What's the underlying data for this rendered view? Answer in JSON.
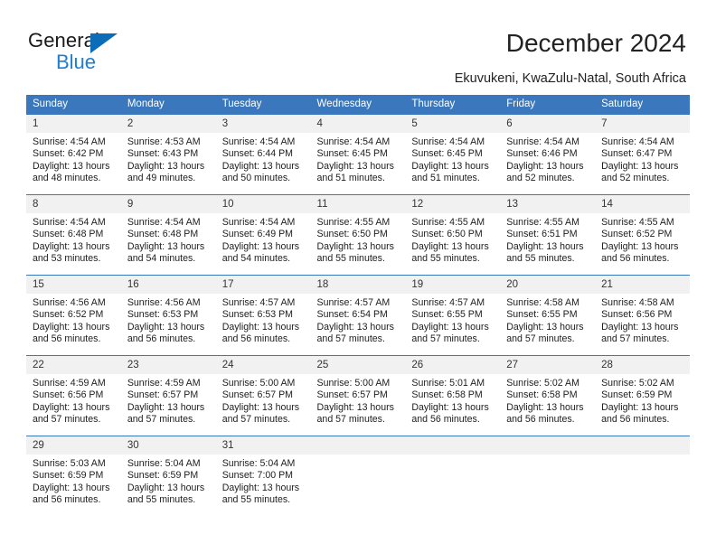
{
  "brand": {
    "name_top": "General",
    "name_bottom": "Blue",
    "triangle_color": "#0b6cb7",
    "blue_text_color": "#1b7fd4"
  },
  "header": {
    "title": "December 2024",
    "location": "Ekuvukeni, KwaZulu-Natal, South Africa"
  },
  "theme": {
    "header_bg": "#3b77bc",
    "daynum_bg": "#f1f1f1",
    "grid_line": "#3b77bc",
    "text": "#1d1d1d"
  },
  "weekdays": [
    "Sunday",
    "Monday",
    "Tuesday",
    "Wednesday",
    "Thursday",
    "Friday",
    "Saturday"
  ],
  "weeks": [
    [
      {
        "day": "1",
        "sunrise": "Sunrise: 4:54 AM",
        "sunset": "Sunset: 6:42 PM",
        "daylight1": "Daylight: 13 hours",
        "daylight2": "and 48 minutes."
      },
      {
        "day": "2",
        "sunrise": "Sunrise: 4:53 AM",
        "sunset": "Sunset: 6:43 PM",
        "daylight1": "Daylight: 13 hours",
        "daylight2": "and 49 minutes."
      },
      {
        "day": "3",
        "sunrise": "Sunrise: 4:54 AM",
        "sunset": "Sunset: 6:44 PM",
        "daylight1": "Daylight: 13 hours",
        "daylight2": "and 50 minutes."
      },
      {
        "day": "4",
        "sunrise": "Sunrise: 4:54 AM",
        "sunset": "Sunset: 6:45 PM",
        "daylight1": "Daylight: 13 hours",
        "daylight2": "and 51 minutes."
      },
      {
        "day": "5",
        "sunrise": "Sunrise: 4:54 AM",
        "sunset": "Sunset: 6:45 PM",
        "daylight1": "Daylight: 13 hours",
        "daylight2": "and 51 minutes."
      },
      {
        "day": "6",
        "sunrise": "Sunrise: 4:54 AM",
        "sunset": "Sunset: 6:46 PM",
        "daylight1": "Daylight: 13 hours",
        "daylight2": "and 52 minutes."
      },
      {
        "day": "7",
        "sunrise": "Sunrise: 4:54 AM",
        "sunset": "Sunset: 6:47 PM",
        "daylight1": "Daylight: 13 hours",
        "daylight2": "and 52 minutes."
      }
    ],
    [
      {
        "day": "8",
        "sunrise": "Sunrise: 4:54 AM",
        "sunset": "Sunset: 6:48 PM",
        "daylight1": "Daylight: 13 hours",
        "daylight2": "and 53 minutes."
      },
      {
        "day": "9",
        "sunrise": "Sunrise: 4:54 AM",
        "sunset": "Sunset: 6:48 PM",
        "daylight1": "Daylight: 13 hours",
        "daylight2": "and 54 minutes."
      },
      {
        "day": "10",
        "sunrise": "Sunrise: 4:54 AM",
        "sunset": "Sunset: 6:49 PM",
        "daylight1": "Daylight: 13 hours",
        "daylight2": "and 54 minutes."
      },
      {
        "day": "11",
        "sunrise": "Sunrise: 4:55 AM",
        "sunset": "Sunset: 6:50 PM",
        "daylight1": "Daylight: 13 hours",
        "daylight2": "and 55 minutes."
      },
      {
        "day": "12",
        "sunrise": "Sunrise: 4:55 AM",
        "sunset": "Sunset: 6:50 PM",
        "daylight1": "Daylight: 13 hours",
        "daylight2": "and 55 minutes."
      },
      {
        "day": "13",
        "sunrise": "Sunrise: 4:55 AM",
        "sunset": "Sunset: 6:51 PM",
        "daylight1": "Daylight: 13 hours",
        "daylight2": "and 55 minutes."
      },
      {
        "day": "14",
        "sunrise": "Sunrise: 4:55 AM",
        "sunset": "Sunset: 6:52 PM",
        "daylight1": "Daylight: 13 hours",
        "daylight2": "and 56 minutes."
      }
    ],
    [
      {
        "day": "15",
        "sunrise": "Sunrise: 4:56 AM",
        "sunset": "Sunset: 6:52 PM",
        "daylight1": "Daylight: 13 hours",
        "daylight2": "and 56 minutes."
      },
      {
        "day": "16",
        "sunrise": "Sunrise: 4:56 AM",
        "sunset": "Sunset: 6:53 PM",
        "daylight1": "Daylight: 13 hours",
        "daylight2": "and 56 minutes."
      },
      {
        "day": "17",
        "sunrise": "Sunrise: 4:57 AM",
        "sunset": "Sunset: 6:53 PM",
        "daylight1": "Daylight: 13 hours",
        "daylight2": "and 56 minutes."
      },
      {
        "day": "18",
        "sunrise": "Sunrise: 4:57 AM",
        "sunset": "Sunset: 6:54 PM",
        "daylight1": "Daylight: 13 hours",
        "daylight2": "and 57 minutes."
      },
      {
        "day": "19",
        "sunrise": "Sunrise: 4:57 AM",
        "sunset": "Sunset: 6:55 PM",
        "daylight1": "Daylight: 13 hours",
        "daylight2": "and 57 minutes."
      },
      {
        "day": "20",
        "sunrise": "Sunrise: 4:58 AM",
        "sunset": "Sunset: 6:55 PM",
        "daylight1": "Daylight: 13 hours",
        "daylight2": "and 57 minutes."
      },
      {
        "day": "21",
        "sunrise": "Sunrise: 4:58 AM",
        "sunset": "Sunset: 6:56 PM",
        "daylight1": "Daylight: 13 hours",
        "daylight2": "and 57 minutes."
      }
    ],
    [
      {
        "day": "22",
        "sunrise": "Sunrise: 4:59 AM",
        "sunset": "Sunset: 6:56 PM",
        "daylight1": "Daylight: 13 hours",
        "daylight2": "and 57 minutes."
      },
      {
        "day": "23",
        "sunrise": "Sunrise: 4:59 AM",
        "sunset": "Sunset: 6:57 PM",
        "daylight1": "Daylight: 13 hours",
        "daylight2": "and 57 minutes."
      },
      {
        "day": "24",
        "sunrise": "Sunrise: 5:00 AM",
        "sunset": "Sunset: 6:57 PM",
        "daylight1": "Daylight: 13 hours",
        "daylight2": "and 57 minutes."
      },
      {
        "day": "25",
        "sunrise": "Sunrise: 5:00 AM",
        "sunset": "Sunset: 6:57 PM",
        "daylight1": "Daylight: 13 hours",
        "daylight2": "and 57 minutes."
      },
      {
        "day": "26",
        "sunrise": "Sunrise: 5:01 AM",
        "sunset": "Sunset: 6:58 PM",
        "daylight1": "Daylight: 13 hours",
        "daylight2": "and 56 minutes."
      },
      {
        "day": "27",
        "sunrise": "Sunrise: 5:02 AM",
        "sunset": "Sunset: 6:58 PM",
        "daylight1": "Daylight: 13 hours",
        "daylight2": "and 56 minutes."
      },
      {
        "day": "28",
        "sunrise": "Sunrise: 5:02 AM",
        "sunset": "Sunset: 6:59 PM",
        "daylight1": "Daylight: 13 hours",
        "daylight2": "and 56 minutes."
      }
    ],
    [
      {
        "day": "29",
        "sunrise": "Sunrise: 5:03 AM",
        "sunset": "Sunset: 6:59 PM",
        "daylight1": "Daylight: 13 hours",
        "daylight2": "and 56 minutes."
      },
      {
        "day": "30",
        "sunrise": "Sunrise: 5:04 AM",
        "sunset": "Sunset: 6:59 PM",
        "daylight1": "Daylight: 13 hours",
        "daylight2": "and 55 minutes."
      },
      {
        "day": "31",
        "sunrise": "Sunrise: 5:04 AM",
        "sunset": "Sunset: 7:00 PM",
        "daylight1": "Daylight: 13 hours",
        "daylight2": "and 55 minutes."
      },
      {
        "day": "",
        "sunrise": "",
        "sunset": "",
        "daylight1": "",
        "daylight2": ""
      },
      {
        "day": "",
        "sunrise": "",
        "sunset": "",
        "daylight1": "",
        "daylight2": ""
      },
      {
        "day": "",
        "sunrise": "",
        "sunset": "",
        "daylight1": "",
        "daylight2": ""
      },
      {
        "day": "",
        "sunrise": "",
        "sunset": "",
        "daylight1": "",
        "daylight2": ""
      }
    ]
  ]
}
